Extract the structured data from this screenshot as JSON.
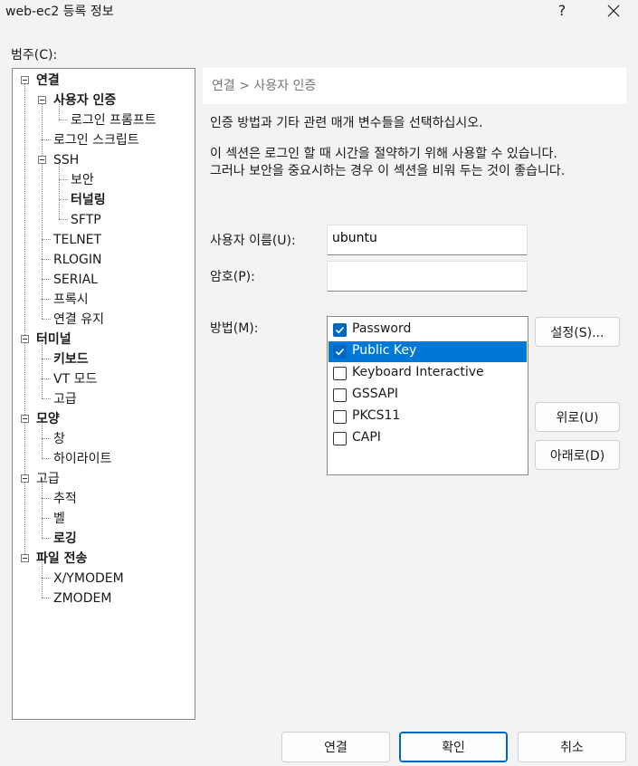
{
  "window": {
    "title": "web-ec2 등록 정보",
    "help_label": "?"
  },
  "category_label": "범주(C):",
  "tree": [
    {
      "label": "연결",
      "bold": true
    },
    {
      "label": "사용자 인증",
      "bold": true
    },
    {
      "label": "로그인 프롬프트",
      "bold": false
    },
    {
      "label": "로그인 스크립트",
      "bold": false
    },
    {
      "label": "SSH",
      "bold": false
    },
    {
      "label": "보안",
      "bold": false
    },
    {
      "label": "터널링",
      "bold": true
    },
    {
      "label": "SFTP",
      "bold": false
    },
    {
      "label": "TELNET",
      "bold": false
    },
    {
      "label": "RLOGIN",
      "bold": false
    },
    {
      "label": "SERIAL",
      "bold": false
    },
    {
      "label": "프록시",
      "bold": false
    },
    {
      "label": "연결 유지",
      "bold": false
    },
    {
      "label": "터미널",
      "bold": true
    },
    {
      "label": "키보드",
      "bold": true
    },
    {
      "label": "VT 모드",
      "bold": false
    },
    {
      "label": "고급",
      "bold": false
    },
    {
      "label": "모양",
      "bold": true
    },
    {
      "label": "창",
      "bold": false
    },
    {
      "label": "하이라이트",
      "bold": false
    },
    {
      "label": "고급",
      "bold": false
    },
    {
      "label": "추적",
      "bold": false
    },
    {
      "label": "벨",
      "bold": false
    },
    {
      "label": "로깅",
      "bold": true
    },
    {
      "label": "파일 전송",
      "bold": true
    },
    {
      "label": "X/YMODEM",
      "bold": false
    },
    {
      "label": "ZMODEM",
      "bold": false
    }
  ],
  "content": {
    "breadcrumb": "연결 > 사용자 인증",
    "description1": "인증 방법과 기타 관련 매개 변수들을 선택하십시오.",
    "description2": "이 섹션은 로그인 할 때 시간을 절약하기 위해 사용할 수 있습니다.",
    "description3": "그러나 보안을 중요시하는 경우 이 섹션을 비워 두는 것이 좋습니다.",
    "username_label": "사용자 이름(U):",
    "username_value": "ubuntu",
    "password_label": "암호(P):",
    "password_value": "",
    "method_label": "방법(M):",
    "methods": [
      {
        "label": "Password",
        "checked": true,
        "selected": false
      },
      {
        "label": "Public Key",
        "checked": true,
        "selected": true
      },
      {
        "label": "Keyboard Interactive",
        "checked": false,
        "selected": false
      },
      {
        "label": "GSSAPI",
        "checked": false,
        "selected": false
      },
      {
        "label": "PKCS11",
        "checked": false,
        "selected": false
      },
      {
        "label": "CAPI",
        "checked": false,
        "selected": false
      }
    ],
    "settings_button": "설정(S)...",
    "up_button": "위로(U)",
    "down_button": "아래로(D)"
  },
  "footer": {
    "connect_button": "연결",
    "ok_button": "확인",
    "cancel_button": "취소"
  },
  "colors": {
    "accent": "#0078d7",
    "background": "#f3f3f3"
  }
}
